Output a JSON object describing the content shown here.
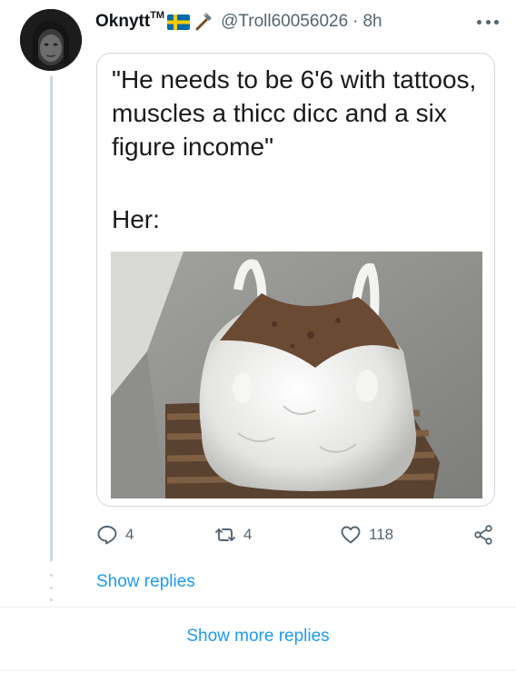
{
  "tweet": {
    "display_name": "Oknytt",
    "tm": "TM",
    "handle": "@Troll60056026",
    "separator": "·",
    "time": "8h",
    "icons": [
      "sweden-flag-icon",
      "hammer-icon",
      "more-icon"
    ],
    "quote_text": "\"He needs to be 6'6 with tattoos,\nmuscles a thicc dicc and a six\nfigure income\"",
    "her_text": "Her:",
    "image": "sack-of-dirt-on-pallet",
    "stats": {
      "replies": "4",
      "retweets": "4",
      "likes": "118"
    }
  },
  "actions": {
    "show_replies": "Show replies",
    "show_more_replies": "Show more replies"
  },
  "colors": {
    "accent": "#1d9bf0",
    "secondary_text": "#536471",
    "border": "#cfd9de",
    "flag_blue": "#006aa7",
    "flag_yellow": "#fecc02"
  }
}
